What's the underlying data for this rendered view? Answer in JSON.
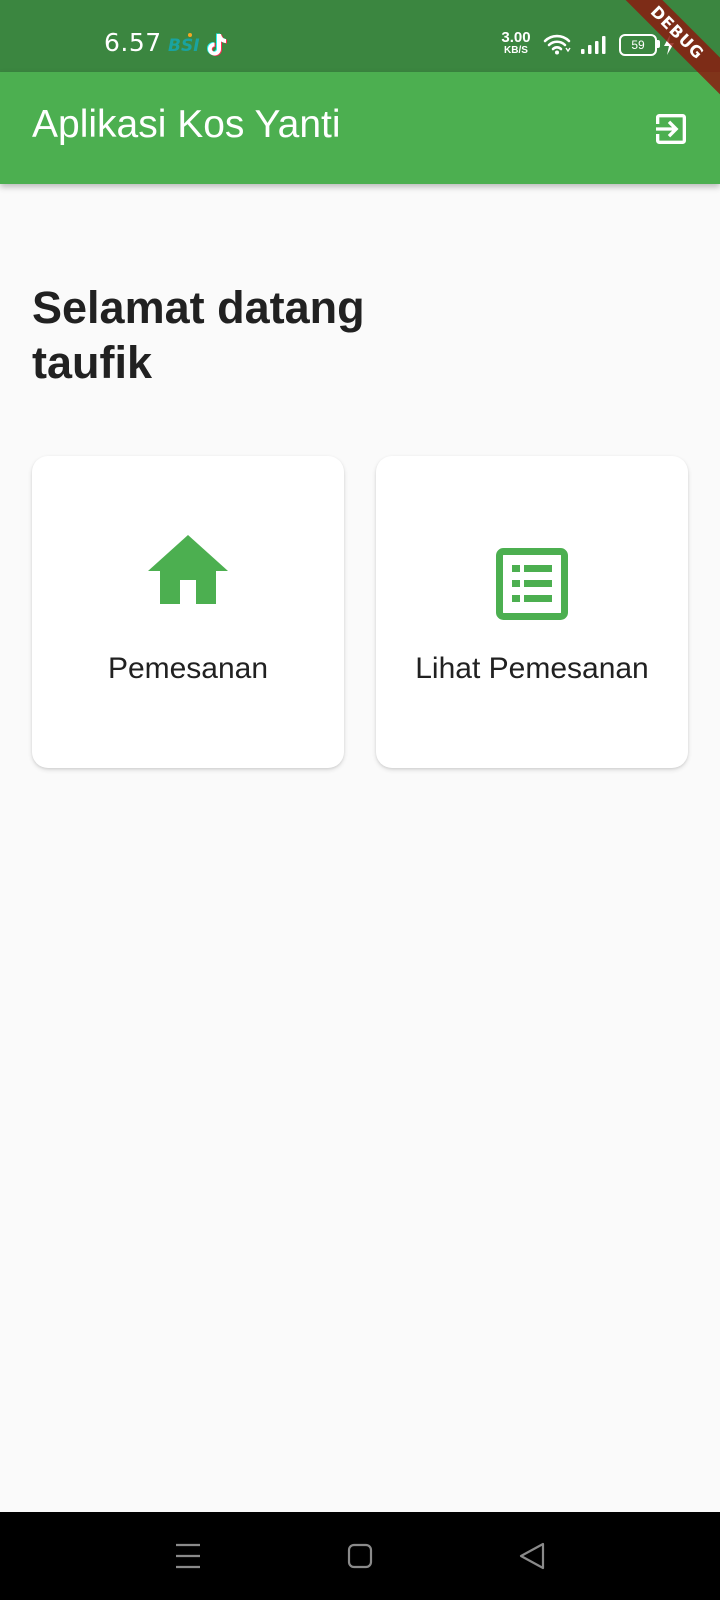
{
  "status_bar": {
    "time": "6.57",
    "bsi_label": "BSI",
    "net_speed_value": "3.00",
    "net_speed_unit": "KB/S",
    "battery_level": "59",
    "debug_label": "DEBUG"
  },
  "app_bar": {
    "title": "Aplikasi Kos Yanti",
    "action_icon": "logout-icon"
  },
  "main": {
    "welcome_text": "Selamat datang taufik",
    "cards": [
      {
        "label": "Pemesanan",
        "icon": "home-icon"
      },
      {
        "label": "Lihat Pemesanan",
        "icon": "list-icon"
      }
    ]
  },
  "nav_bar": {
    "buttons": [
      "menu-icon",
      "home-square-icon",
      "back-triangle-icon"
    ]
  },
  "colors": {
    "status_bar": "#3b8640",
    "app_bar": "#4caf50",
    "accent": "#4caf50",
    "background": "#fafafa",
    "text": "#212121"
  }
}
